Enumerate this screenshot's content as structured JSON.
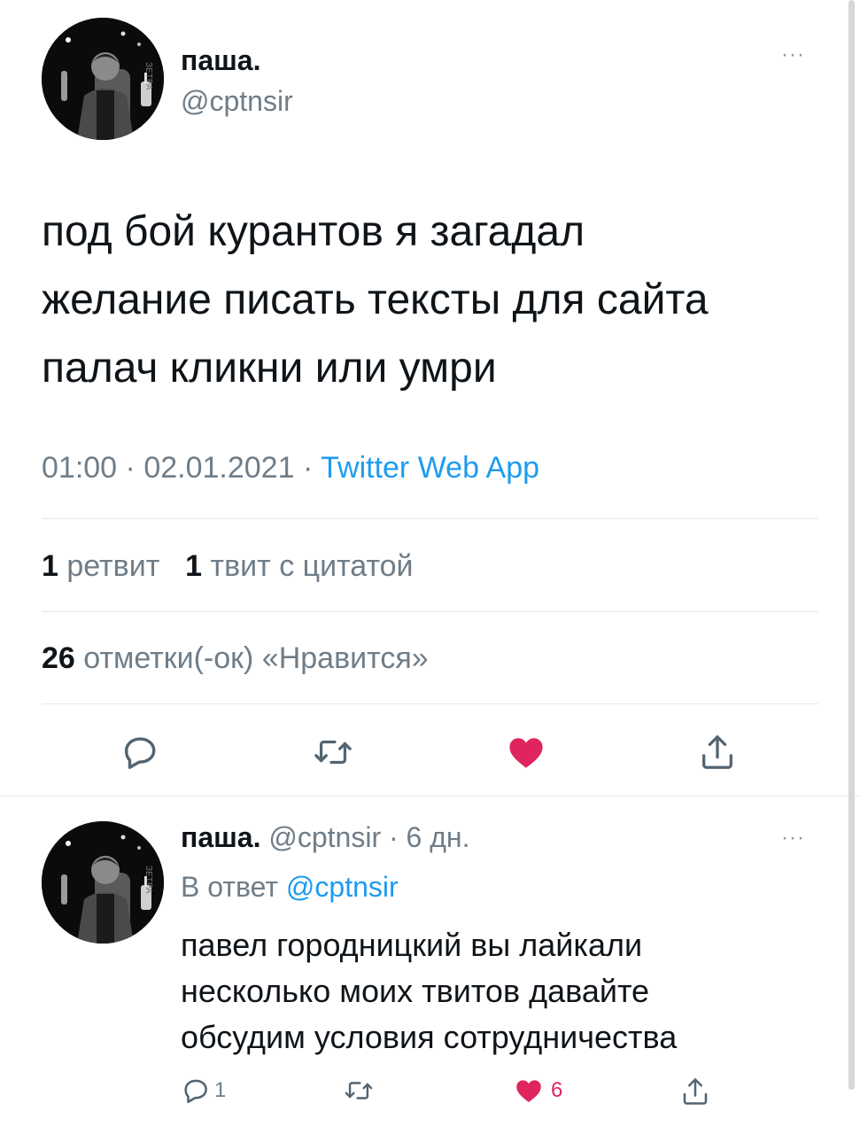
{
  "main_tweet": {
    "author_name": "паша.",
    "handle": "@cptnsir",
    "text_lines": [
      "под бой курантов я загадал",
      "желание писать тексты для сайта",
      "палач кликни или умри"
    ],
    "time": "01:00",
    "date": "02.01.2021",
    "separator": "·",
    "source": "Twitter Web App",
    "retweets_count": "1",
    "retweets_label": "ретвит",
    "quotes_count": "1",
    "quotes_label": "твит с цитатой",
    "likes_count": "26",
    "likes_label": "отметки(-ок) «Нравится»",
    "more": "···"
  },
  "reply_tweet": {
    "author_name": "паша.",
    "handle": "@cptnsir",
    "separator": "·",
    "age": "6 дн.",
    "reply_prefix": "В ответ",
    "reply_to": "@cptnsir",
    "text_lines": [
      "павел городницкий вы лайкали",
      "несколько моих твитов давайте",
      "обсудим условия сотрудничества"
    ],
    "reply_count": "1",
    "like_count": "6",
    "more": "···"
  },
  "icons": [
    "reply-icon",
    "retweet-icon",
    "heart-icon",
    "share-icon",
    "more-icon"
  ],
  "colors": {
    "like_active": "#e0245e",
    "link": "#1d9bf0",
    "muted": "#6f7d88",
    "icon": "#536471"
  }
}
